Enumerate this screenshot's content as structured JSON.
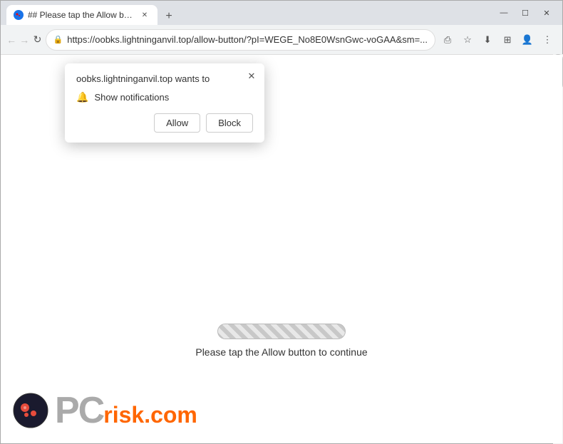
{
  "window": {
    "title": "## Please tap the Allow button",
    "tab_title": "## Please tap the Allow button",
    "controls": {
      "minimize": "—",
      "maximize": "☐",
      "close": "✕"
    }
  },
  "address_bar": {
    "url": "https://oobks.lightninganvil.top/allow-button/?pI=WEGE_No8E0WsnGwc-voGAA&sm=...",
    "back": "←",
    "forward": "→",
    "refresh": "↻"
  },
  "notification_popup": {
    "title": "oobks.lightninganvil.top wants to",
    "permission": "Show notifications",
    "allow_label": "Allow",
    "block_label": "Block",
    "close": "✕"
  },
  "page": {
    "message": "Please tap the Allow button to continue"
  },
  "pcrisk": {
    "text_pc": "PC",
    "text_risk": "risk.com"
  },
  "new_tab_icon": "+",
  "icons": {
    "lock": "🔒",
    "bell": "🔔",
    "share": "⎙",
    "star": "☆",
    "download": "⬇",
    "extensions": "⊞",
    "profile": "👤",
    "menu": "⋮"
  }
}
